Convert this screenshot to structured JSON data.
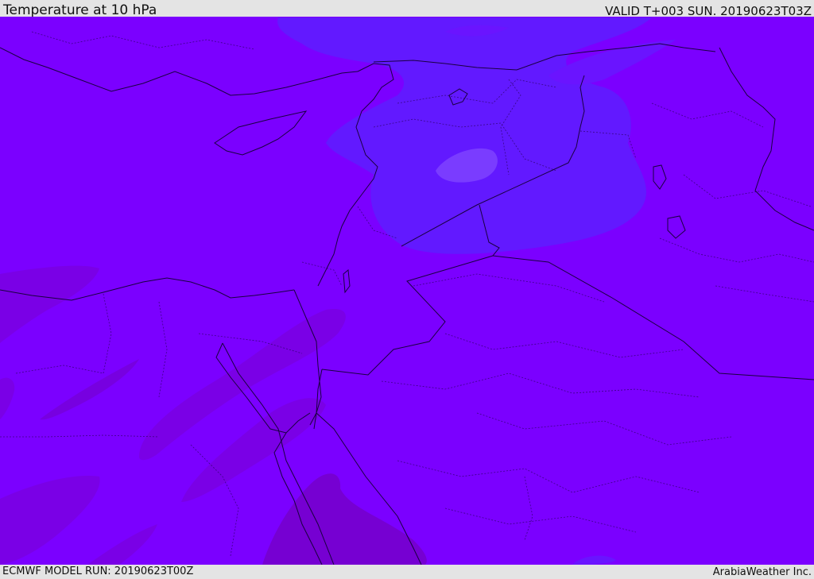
{
  "header": {
    "title": "Temperature at 10 hPa",
    "valid": "VALID T+003 SUN. 20190623T03Z"
  },
  "footer": {
    "model_run": "ECMWF MODEL RUN: 20190623T00Z",
    "credit": "ArabiaWeather Inc."
  },
  "colors": {
    "base_field": "#7b00ff",
    "cool_field": "#6219ff",
    "cooler_field": "#7a3cff",
    "warm_field": "#7a00e6",
    "warmer_field": "#7600d2",
    "coast_border": "#1a0040"
  }
}
